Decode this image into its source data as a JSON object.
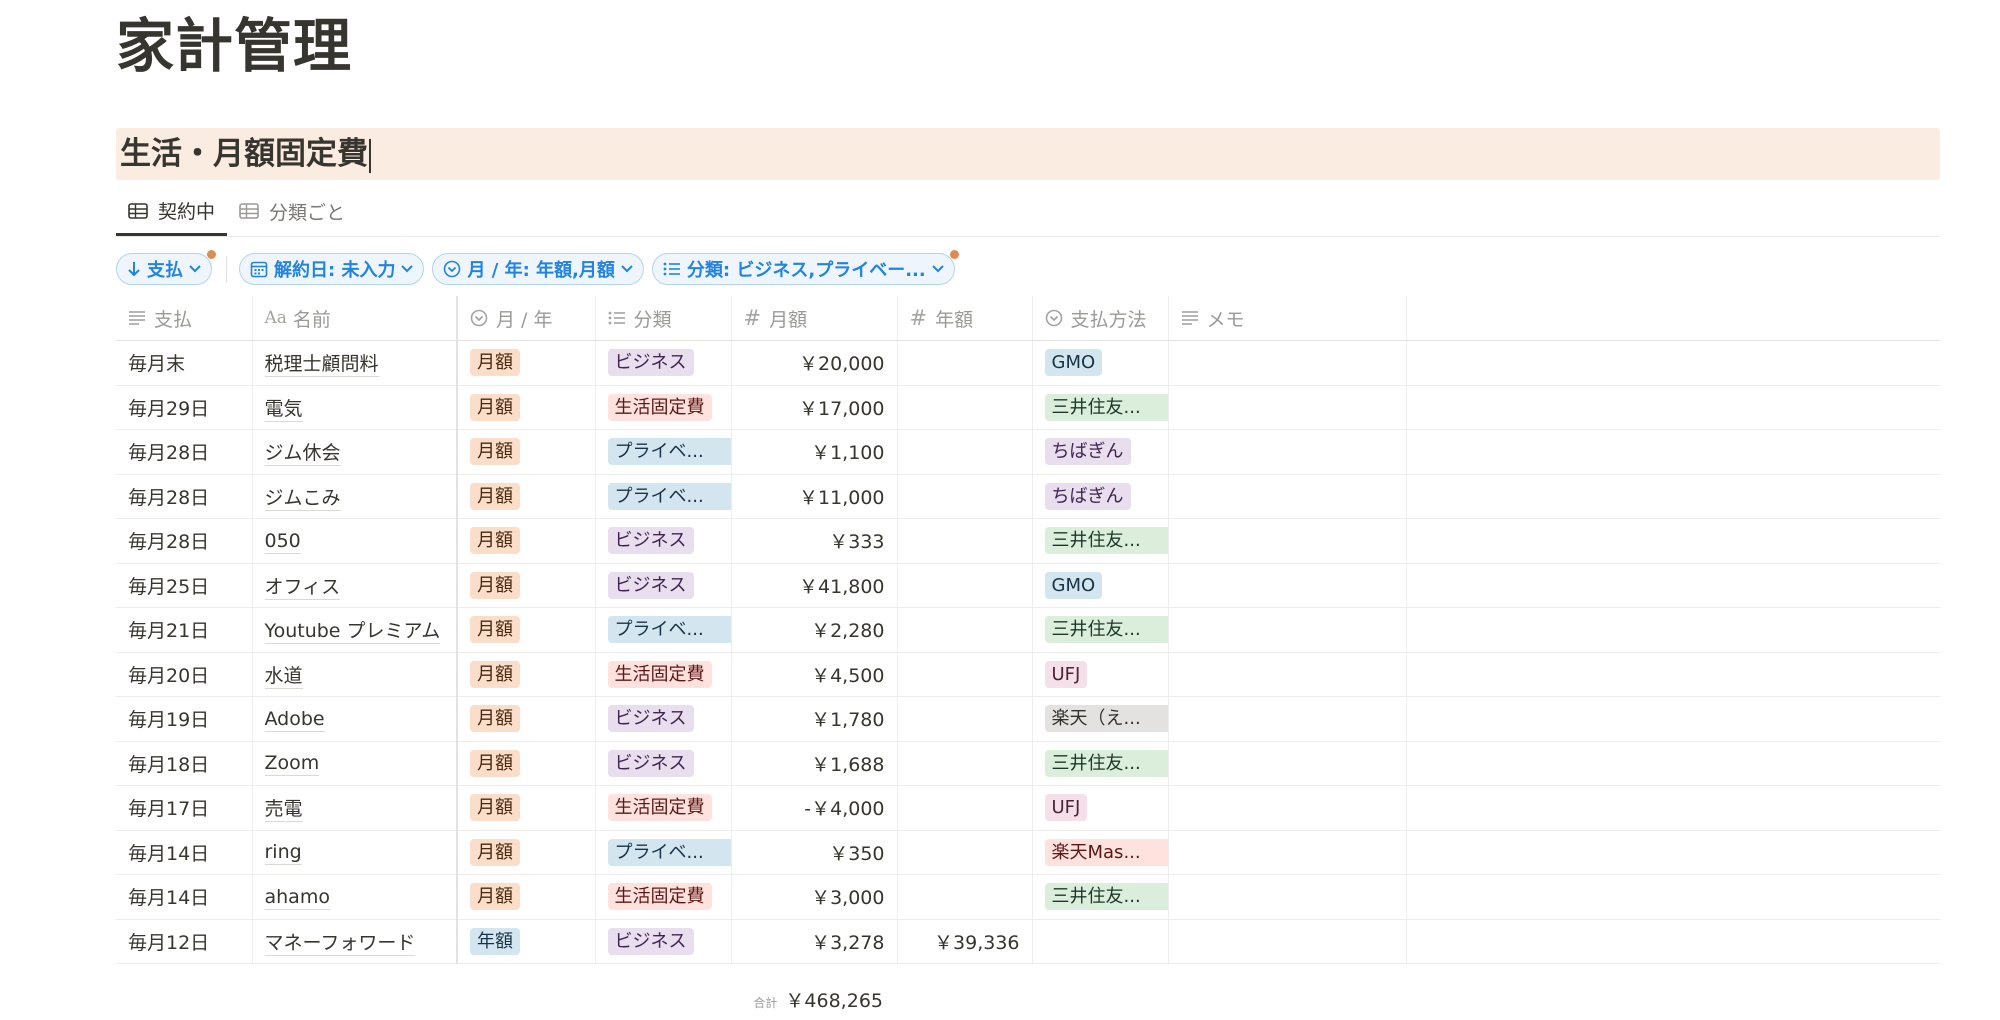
{
  "page": {
    "title": "家計管理",
    "section_title": "生活・月額固定費"
  },
  "tabs": [
    {
      "label": "契約中",
      "active": true
    },
    {
      "label": "分類ごと",
      "active": false
    }
  ],
  "filters": {
    "sort_label": "支払",
    "f1_label": "解約日: 未入力",
    "f2_label": "月 / 年: 年額,月額",
    "f3_label": "分類: ビジネス,プライベー..."
  },
  "columns": {
    "pay": "支払",
    "name": "名前",
    "period": "月 / 年",
    "category": "分類",
    "monthly": "月額",
    "yearly": "年額",
    "method": "支払方法",
    "memo": "メモ"
  },
  "rows": [
    {
      "pay": "毎月末",
      "name": "税理士顧問料",
      "period": "月額",
      "category": "ビジネス",
      "monthly": "￥20,000",
      "yearly": "",
      "method": "GMO",
      "memo": ""
    },
    {
      "pay": "毎月29日",
      "name": "電気",
      "period": "月額",
      "category": "生活固定費",
      "monthly": "￥17,000",
      "yearly": "",
      "method": "三井住友...",
      "memo": ""
    },
    {
      "pay": "毎月28日",
      "name": "ジム休会",
      "period": "月額",
      "category": "プライベ...",
      "monthly": "￥1,100",
      "yearly": "",
      "method": "ちばぎん",
      "memo": ""
    },
    {
      "pay": "毎月28日",
      "name": "ジムこみ",
      "period": "月額",
      "category": "プライベ...",
      "monthly": "￥11,000",
      "yearly": "",
      "method": "ちばぎん",
      "memo": ""
    },
    {
      "pay": "毎月28日",
      "name": "050",
      "period": "月額",
      "category": "ビジネス",
      "monthly": "￥333",
      "yearly": "",
      "method": "三井住友...",
      "memo": ""
    },
    {
      "pay": "毎月25日",
      "name": "オフィス",
      "period": "月額",
      "category": "ビジネス",
      "monthly": "￥41,800",
      "yearly": "",
      "method": "GMO",
      "memo": ""
    },
    {
      "pay": "毎月21日",
      "name": "Youtube プレミアム",
      "period": "月額",
      "category": "プライベ...",
      "monthly": "￥2,280",
      "yearly": "",
      "method": "三井住友...",
      "memo": ""
    },
    {
      "pay": "毎月20日",
      "name": "水道",
      "period": "月額",
      "category": "生活固定費",
      "monthly": "￥4,500",
      "yearly": "",
      "method": "UFJ",
      "memo": ""
    },
    {
      "pay": "毎月19日",
      "name": "Adobe",
      "period": "月額",
      "category": "ビジネス",
      "monthly": "￥1,780",
      "yearly": "",
      "method": "楽天（え...",
      "memo": ""
    },
    {
      "pay": "毎月18日",
      "name": "Zoom",
      "period": "月額",
      "category": "ビジネス",
      "monthly": "￥1,688",
      "yearly": "",
      "method": "三井住友...",
      "memo": ""
    },
    {
      "pay": "毎月17日",
      "name": "売電",
      "period": "月額",
      "category": "生活固定費",
      "monthly": "-￥4,000",
      "yearly": "",
      "method": "UFJ",
      "memo": ""
    },
    {
      "pay": "毎月14日",
      "name": "ring",
      "period": "月額",
      "category": "プライベ...",
      "monthly": "￥350",
      "yearly": "",
      "method": "楽天Mas...",
      "memo": ""
    },
    {
      "pay": "毎月14日",
      "name": "ahamo",
      "period": "月額",
      "category": "生活固定費",
      "monthly": "￥3,000",
      "yearly": "",
      "method": "三井住友...",
      "memo": ""
    },
    {
      "pay": "毎月12日",
      "name": "マネーフォワード",
      "period": "年額",
      "category": "ビジネス",
      "monthly": "￥3,278",
      "yearly": "￥39,336",
      "method": "",
      "memo": ""
    }
  ],
  "summary": {
    "label": "合計",
    "monthly_total": "￥468,265"
  },
  "tag_colors": {
    "月額": "tag-orange",
    "年額": "tag-blue",
    "ビジネス": "tag-purple",
    "生活固定費": "tag-red",
    "プライベ...": "tag-blue",
    "GMO": "tag-blue",
    "三井住友...": "tag-green",
    "ちばぎん": "tag-purple",
    "UFJ": "tag-pink",
    "楽天（え...": "tag-gray",
    "楽天Mas...": "tag-red"
  }
}
